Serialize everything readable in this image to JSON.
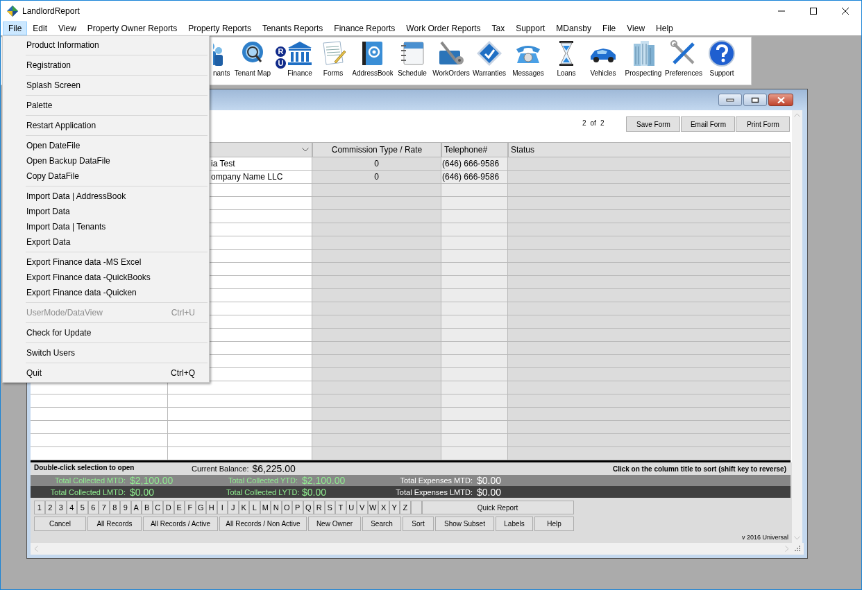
{
  "window": {
    "title": "LandlordReport"
  },
  "menubar": [
    {
      "label": "File",
      "selected": true
    },
    {
      "label": "Edit",
      "selected": false
    },
    {
      "label": "View",
      "selected": false
    },
    {
      "label": "Property Owner Reports",
      "selected": false
    },
    {
      "label": "Property Reports",
      "selected": false
    },
    {
      "label": "Tenants Reports",
      "selected": false
    },
    {
      "label": "Finance Reports",
      "selected": false
    },
    {
      "label": "Work Order Reports",
      "selected": false
    },
    {
      "label": "Tax",
      "selected": false
    },
    {
      "label": "Support",
      "selected": false
    },
    {
      "label": "MDansby",
      "selected": false
    },
    {
      "label": "File",
      "selected": false
    },
    {
      "label": "View",
      "selected": false
    },
    {
      "label": "Help",
      "selected": false
    }
  ],
  "toolbar": [
    {
      "label": "nants"
    },
    {
      "label": "Tenant Map"
    },
    {
      "kind": "badges",
      "badges": [
        "R",
        "U"
      ]
    },
    {
      "label": "Finance"
    },
    {
      "label": "Forms"
    },
    {
      "label": "AddressBook"
    },
    {
      "label": "Schedule"
    },
    {
      "label": "WorkOrders"
    },
    {
      "label": "Warranties"
    },
    {
      "label": "Messages"
    },
    {
      "label": "Loans"
    },
    {
      "label": "Vehicles"
    },
    {
      "label": "Prospecting"
    },
    {
      "label": "Preferences"
    },
    {
      "label": "Support"
    }
  ],
  "file_menu": [
    [
      {
        "label": "Product Information",
        "disabled": false
      }
    ],
    [
      {
        "label": "Registration",
        "disabled": false
      }
    ],
    [
      {
        "label": "Splash Screen",
        "disabled": false
      }
    ],
    [
      {
        "label": "Palette",
        "disabled": false
      }
    ],
    [
      {
        "label": "Restart Application",
        "disabled": false
      }
    ],
    [
      {
        "label": "Open DateFile",
        "disabled": false
      },
      {
        "label": "Open Backup DataFile",
        "disabled": false
      },
      {
        "label": "Copy DataFile",
        "disabled": false
      }
    ],
    [
      {
        "label": "Import Data | AddressBook",
        "disabled": false
      },
      {
        "label": "Import Data",
        "disabled": false
      },
      {
        "label": "Import Data | Tenants",
        "disabled": false
      },
      {
        "label": "Export Data",
        "disabled": false
      }
    ],
    [
      {
        "label": "Export Finance data -MS Excel",
        "disabled": false
      },
      {
        "label": "Export Finance data -QuickBooks",
        "disabled": false
      },
      {
        "label": "Export Finance data -Quicken",
        "disabled": false
      }
    ],
    [
      {
        "label": "UserMode/DataView",
        "shortcut": "Ctrl+U",
        "disabled": true
      }
    ],
    [
      {
        "label": "Check for Update",
        "disabled": false
      }
    ],
    [
      {
        "label": "Switch Users",
        "disabled": false
      }
    ],
    [
      {
        "label": "Quit",
        "shortcut": "Ctrl+Q",
        "disabled": false
      }
    ]
  ],
  "form": {
    "page": "2",
    "page_of": "of",
    "page_total": "2",
    "buttons": [
      "Save Form",
      "Email Form",
      "Print Form"
    ],
    "table": {
      "columns": [
        {
          "kind": "blank"
        },
        {
          "kind": "dropdown"
        },
        {
          "kind": "text",
          "label": "Commission Type / Rate"
        },
        {
          "kind": "text",
          "label": "Telephone#"
        },
        {
          "kind": "text",
          "label": "Status"
        }
      ],
      "rows": [
        {
          "name": "ia Test",
          "commission": "0",
          "telephone": "(646) 666-9586"
        },
        {
          "name": "ompany Name LLC",
          "commission": "0",
          "telephone": "(646) 666-9586"
        }
      ]
    },
    "hint": "Double-click selection to open",
    "balance_label": "Current Balance:",
    "balance": "$6,225.00",
    "sort_hint": "Click on the column title to sort (shift key to reverse)",
    "totals": [
      [
        {
          "kind": "collected",
          "label": "Total Collected MTD:",
          "value": "$2,100.00"
        },
        {
          "kind": "collected",
          "label": "Total Collected YTD:",
          "value": "$2,100.00"
        },
        {
          "kind": "expenses",
          "label": "Total Expenses MTD:",
          "value": "$0.00"
        }
      ],
      [
        {
          "kind": "collected",
          "label": "Total Collected LMTD:",
          "value": "$0.00"
        },
        {
          "kind": "collected",
          "label": "Total Collected LYTD:",
          "value": "$0.00"
        },
        {
          "kind": "expenses",
          "label": "Total Expenses LMTD:",
          "value": "$0.00"
        }
      ]
    ],
    "keys": [
      "1",
      "2",
      "3",
      "4",
      "5",
      "6",
      "7",
      "8",
      "9",
      "A",
      "B",
      "C",
      "D",
      "E",
      "F",
      "G",
      "H",
      "I",
      "J",
      "K",
      "L",
      "M",
      "N",
      "O",
      "P",
      "Q",
      "R",
      "S",
      "T",
      "U",
      "V",
      "W",
      "X",
      "Y",
      "Z"
    ],
    "quick_report": "Quick Report",
    "actions": [
      "Cancel",
      "All Records",
      "All Records / Active",
      "All Records / Non Active",
      "New Owner",
      "Search",
      "Sort",
      "Show Subset",
      "Labels",
      "Help"
    ],
    "version": "v 2016 Universal"
  }
}
